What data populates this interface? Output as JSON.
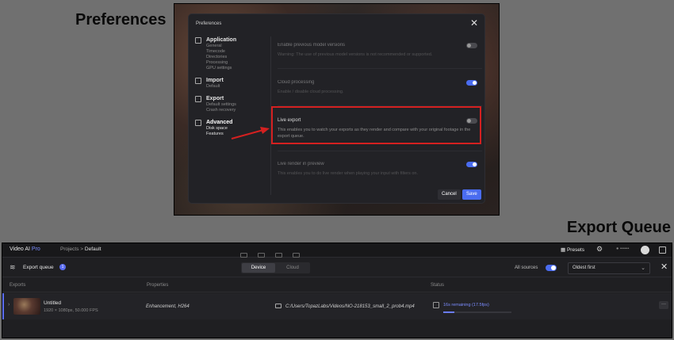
{
  "captions": {
    "preferences": "Preferences",
    "export_queue": "Export Queue"
  },
  "preferences": {
    "title": "Preferences",
    "close_icon": "close-icon",
    "sidebar": [
      {
        "title": "Application",
        "icon": "application-icon",
        "items": [
          "General",
          "Timecode",
          "Directories",
          "Processing",
          "GPU settings"
        ]
      },
      {
        "title": "Import",
        "icon": "import-icon",
        "items": [
          "Default"
        ]
      },
      {
        "title": "Export",
        "icon": "export-icon",
        "items": [
          "Default settings",
          "Crash recovery"
        ]
      },
      {
        "title": "Advanced",
        "icon": "advanced-icon",
        "items": [
          "Disk space",
          "Features"
        ]
      }
    ],
    "options": [
      {
        "title": "Enable previous model versions",
        "desc": "Warning: The use of previous model versions is not recommended or supported.",
        "enabled": false
      },
      {
        "title": "Cloud processing",
        "desc": "Enable / disable cloud processing.",
        "enabled": true
      },
      {
        "title": "Live export",
        "desc": "This enables you to watch your exports as they render and compare with your original footage in the export queue.",
        "enabled": false
      },
      {
        "title": "Live render in preview",
        "desc": "This enables you to do live render when playing your input with filters on.",
        "enabled": true
      }
    ],
    "buttons": {
      "cancel": "Cancel",
      "save": "Save"
    },
    "highlight_color": "#d42020"
  },
  "queue": {
    "brand": "Video AI",
    "brand_suffix": "Pro",
    "breadcrumb": {
      "root": "Projects",
      "separator": ">",
      "current": "Default"
    },
    "presets_label": "Presets",
    "credits": "••••••",
    "title": "Export queue",
    "count": "1",
    "segments": {
      "device": "Device",
      "cloud": "Cloud"
    },
    "all_sources_label": "All sources",
    "all_sources_on": true,
    "sort": {
      "selected": "Oldest first"
    },
    "columns": {
      "exports": "Exports",
      "properties": "Properties",
      "status": "Status"
    },
    "rows": [
      {
        "name": "Untitled",
        "meta": "1920 × 1080px, 50.000 FPS",
        "properties": "Enhancement, H264",
        "path": "C:/Users/TopazLabs/Videos/NO-218153_small_2_prob4.mp4",
        "remaining": "16s remaining (17.5fps)",
        "progress": 0.16
      }
    ],
    "accent_color": "#5a6cf0"
  }
}
